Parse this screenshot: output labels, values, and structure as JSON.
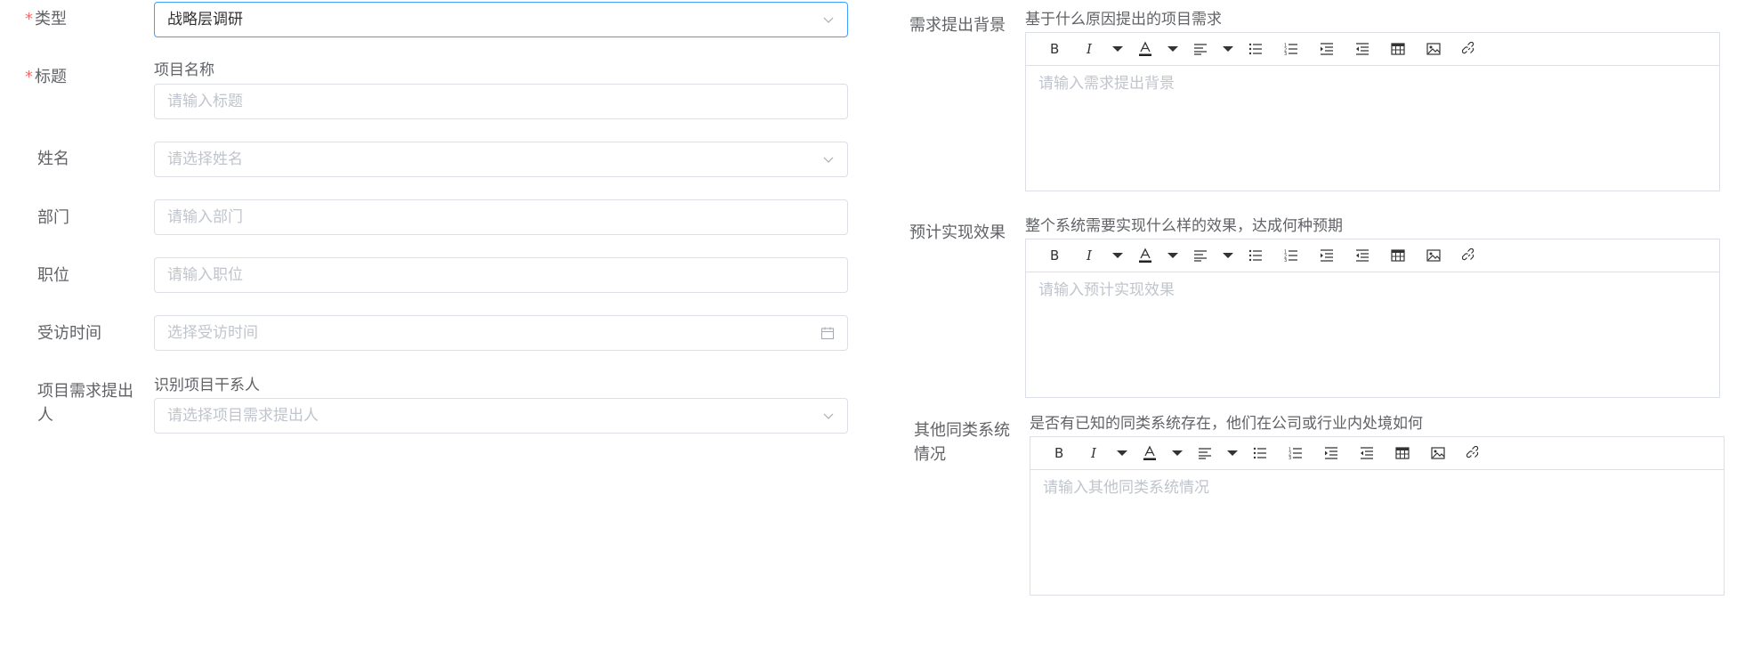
{
  "left": {
    "type": {
      "label": "类型",
      "value": "战略层调研"
    },
    "title": {
      "label": "标题",
      "hint": "项目名称",
      "placeholder": "请输入标题"
    },
    "name": {
      "label": "姓名",
      "placeholder": "请选择姓名"
    },
    "dept": {
      "label": "部门",
      "placeholder": "请输入部门"
    },
    "position": {
      "label": "职位",
      "placeholder": "请输入职位"
    },
    "visit_time": {
      "label": "受访时间",
      "placeholder": "选择受访时间"
    },
    "proposer": {
      "label_line1": "项目需求提出",
      "label_line2": "人",
      "hint": "识别项目干系人",
      "placeholder": "请选择项目需求提出人"
    }
  },
  "right": {
    "background": {
      "label": "需求提出背景",
      "hint": "基于什么原因提出的项目需求",
      "placeholder": "请输入需求提出背景"
    },
    "effect": {
      "label": "预计实现效果",
      "hint": "整个系统需要实现什么样的效果，达成何种预期",
      "placeholder": "请输入预计实现效果"
    },
    "similar": {
      "label_line1": "其他同类系统",
      "label_line2": "情况",
      "hint": "是否有已知的同类系统存在，他们在公司或行业内处境如何",
      "placeholder": "请输入其他同类系统情况"
    }
  },
  "required_mark": "*",
  "toolbar_icons": [
    "bold-icon",
    "italic-icon",
    "dropdown-icon",
    "font-color-icon",
    "dropdown-icon",
    "align-icon",
    "dropdown-icon",
    "bullet-list-icon",
    "numbered-list-icon",
    "indent-icon",
    "outdent-icon",
    "table-icon",
    "image-icon",
    "link-icon"
  ],
  "colors": {
    "required": "#f56c6c",
    "active_border": "#409eff",
    "border": "#dcdfe6",
    "placeholder": "#c0c4cc",
    "label": "#606266"
  }
}
